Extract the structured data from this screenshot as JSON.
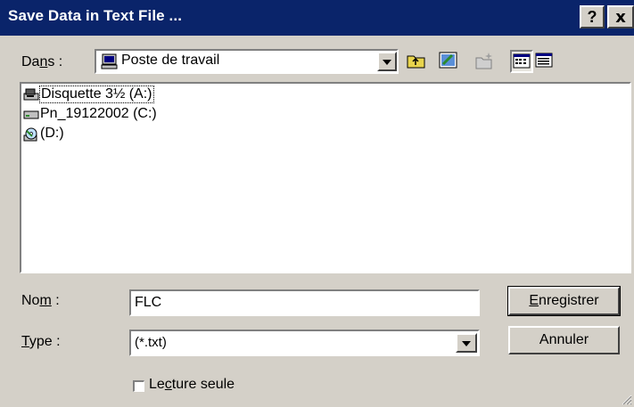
{
  "window": {
    "title": "Save Data in Text File ...",
    "help_button": "?",
    "close_button": "x"
  },
  "location": {
    "label_pre": "Da",
    "label_ul": "n",
    "label_post": "s :",
    "selected": "Poste de travail"
  },
  "toolbar": {
    "icons": [
      "up-folder-icon",
      "desktop-icon",
      "new-folder-icon",
      "list-view-icon",
      "details-view-icon"
    ]
  },
  "file_list": {
    "items": [
      {
        "label": "Disquette 3½ (A:)",
        "icon": "floppy-drive-icon",
        "selected": true
      },
      {
        "label": "Pn_19122002 (C:)",
        "icon": "hard-drive-icon",
        "selected": false
      },
      {
        "label": "(D:)",
        "icon": "cd-drive-icon",
        "selected": false
      }
    ]
  },
  "filename": {
    "label_pre": "No",
    "label_ul": "m",
    "label_post": " :",
    "value": "FLC"
  },
  "filetype": {
    "label_ul": "T",
    "label_post": "ype :",
    "selected": "(*.txt)"
  },
  "readonly": {
    "label_pre": "Le",
    "label_ul": "c",
    "label_post": "ture seule",
    "checked": false
  },
  "buttons": {
    "save_ul": "E",
    "save_post": "nregistrer",
    "cancel": "Annuler"
  }
}
